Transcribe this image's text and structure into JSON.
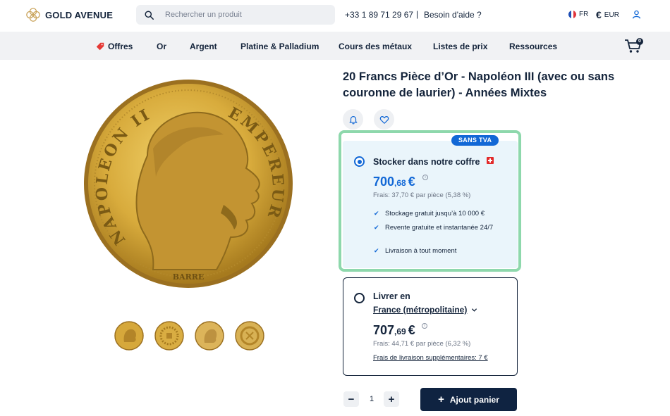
{
  "header": {
    "brand": "GOLD AVENUE",
    "search_placeholder": "Rechercher un produit",
    "phone": "+33 1 89 71 29 67",
    "separator": "|",
    "help": "Besoin d'aide ?",
    "language": "FR",
    "currency_symbol": "€",
    "currency": "EUR"
  },
  "nav": {
    "items": [
      "Offres",
      "Or",
      "Argent",
      "Platine & Palladium",
      "Cours des métaux",
      "Listes de prix",
      "Ressources"
    ],
    "cart_count": "0"
  },
  "product": {
    "title": "20 Francs Pièce d’Or - Napoléon III (avec ou sans couronne de laurier) - Années Mixtes",
    "coin_inscription_left": "NAPOLEON III",
    "coin_inscription_right": "EMPEREUR",
    "coin_engraver": "BARRE"
  },
  "options": {
    "badge": "SANS TVA",
    "storage": {
      "title": "Stocker dans notre coffre",
      "price_int": "700",
      "price_dec": ",68",
      "price_cur": "€",
      "fees": "Frais: 37,70 € par pièce (5,38 %)",
      "features": [
        "Stockage gratuit jusqu’à 10 000 €",
        "Revente gratuite et instantanée 24/7",
        "Livraison à tout moment"
      ],
      "selected": true
    },
    "delivery": {
      "title": "Livrer en",
      "country": "France (métropolitaine)",
      "price_int": "707",
      "price_dec": ",69",
      "price_cur": "€",
      "fees": "Frais: 44,71 € par pièce (6,32 %)",
      "shipping_link": "Frais de livraison supplémentaires: 7 €",
      "selected": false
    }
  },
  "purchase": {
    "minus": "−",
    "plus": "+",
    "quantity": "1",
    "add_label": "Ajout panier",
    "add_icon": "+"
  },
  "colors": {
    "navy": "#14243b",
    "accent_blue": "#1268d6",
    "highlight_green": "#8ed8ac",
    "gold": "#d2a53a"
  }
}
